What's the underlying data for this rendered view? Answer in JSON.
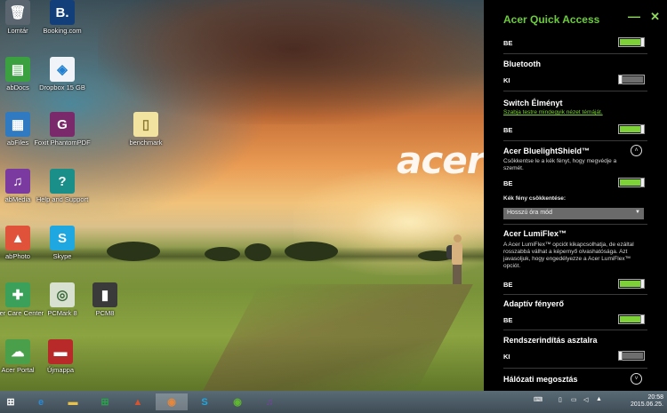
{
  "desktop": {
    "icons": [
      {
        "label": "Lomtár",
        "glyph": "🗑"
      },
      {
        "label": "Booking.com",
        "glyph": "B."
      },
      {
        "label": "abDocs",
        "glyph": "▤"
      },
      {
        "label": "Dropbox 15 GB",
        "glyph": "◈"
      },
      {
        "label": "abFiles",
        "glyph": "▦"
      },
      {
        "label": "Foxit PhantomPDF",
        "glyph": "G"
      },
      {
        "label": "benchmark",
        "glyph": "▯"
      },
      {
        "label": "abMedia",
        "glyph": "♫"
      },
      {
        "label": "Help and Support",
        "glyph": "?"
      },
      {
        "label": "abPhoto",
        "glyph": "▲"
      },
      {
        "label": "Skype",
        "glyph": "S"
      },
      {
        "label": "Acer Care Center",
        "glyph": "✚"
      },
      {
        "label": "PCMark 8",
        "glyph": "◎"
      },
      {
        "label": "PCM8",
        "glyph": "▮"
      },
      {
        "label": "Acer Portal",
        "glyph": "☁"
      },
      {
        "label": "Újmappa",
        "glyph": "▬"
      }
    ],
    "wallpaper_text": "acer"
  },
  "panel": {
    "title": "Acer Quick Access",
    "minimize_glyph": "—",
    "close_glyph": "✕",
    "top_state": "BE",
    "bluetooth": {
      "title": "Bluetooth",
      "state": "KI"
    },
    "switch": {
      "title": "Switch Élményt",
      "link": "Szabja testre mindegyik nézet témáját.",
      "state": "BE"
    },
    "bluelight": {
      "title": "Acer BluelightShield™",
      "desc": "Csökkentse le a kék fényt, hogy megvédje a szemét.",
      "state": "BE",
      "reduce_label": "Kék fény csökkentése:",
      "select_value": "Hosszú óra mód",
      "chevron": "˄"
    },
    "lumiflex": {
      "title": "Acer LumiFlex™",
      "desc": "A Acer LumiFlex™ opciót kikapcsolhatja, de ezáltal rosszabbá válhat a képernyő olvashatósága. Azt javasoljuk, hogy engedélyezze a Acer LumiFlex™ opciót.",
      "state": "BE"
    },
    "adaptive": {
      "title": "Adaptív fényerő",
      "state": "BE"
    },
    "boot": {
      "title": "Rendszerindítás asztalra",
      "state": "KI"
    },
    "network": {
      "title": "Hálózati megosztás",
      "chevron": "˅"
    }
  },
  "taskbar": {
    "start_glyph": "⊞",
    "apps": [
      {
        "name": "ie",
        "glyph": "e",
        "color": "#2a8ad4"
      },
      {
        "name": "explorer",
        "glyph": "▬",
        "color": "#e8c24a"
      },
      {
        "name": "store",
        "glyph": "⊞",
        "color": "#2aa24a"
      },
      {
        "name": "photo",
        "glyph": "▲",
        "color": "#d9532f"
      },
      {
        "name": "acer-care",
        "glyph": "◉",
        "color": "#e8873a"
      },
      {
        "name": "skype",
        "glyph": "S",
        "color": "#1ea7e1"
      },
      {
        "name": "spotify",
        "glyph": "◉",
        "color": "#5fb830"
      },
      {
        "name": "media",
        "glyph": "♫",
        "color": "#7b3fa8"
      }
    ],
    "time": "20:58",
    "date": "2015.06.25."
  }
}
